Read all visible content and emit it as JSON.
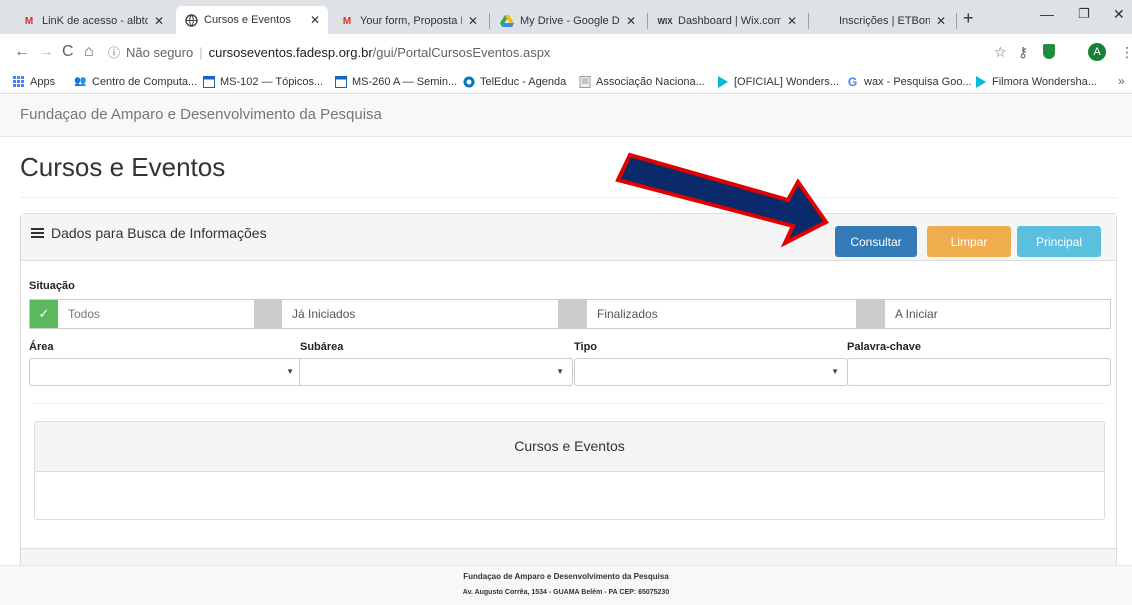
{
  "browser": {
    "tabs": [
      {
        "title": "LinK de acesso - albtdia",
        "icon": "gmail-icon"
      },
      {
        "title": "Cursos e Eventos",
        "icon": "globe-icon",
        "active": true
      },
      {
        "title": "Your form, Proposta ET",
        "icon": "gmail-icon"
      },
      {
        "title": "My Drive - Google Drive",
        "icon": "drive-icon"
      },
      {
        "title": "Dashboard | Wix.com",
        "icon": "wix-icon"
      },
      {
        "title": "Inscrições | ETBonline",
        "icon": "blank-icon"
      }
    ],
    "tab_close": "✕",
    "new_tab": "+",
    "url": {
      "security": "Não seguro",
      "host": "cursoseventos.fadesp.org.br",
      "path": "/gui/PortalCursosEventos.aspx"
    },
    "avatar_letter": "A",
    "bookmarks": [
      {
        "label": "Apps",
        "icon": "apps-grid-icon"
      },
      {
        "label": "Centro de Computa...",
        "icon": "people-icon"
      },
      {
        "label": "MS-102 — Tópicos...",
        "icon": "calendar-icon"
      },
      {
        "label": "MS-260 A — Semin...",
        "icon": "calendar-icon"
      },
      {
        "label": "TelEduc - Agenda",
        "icon": "teleduc-icon"
      },
      {
        "label": "Associação Naciona...",
        "icon": "doc-icon"
      },
      {
        "label": "[OFICIAL] Wonders...",
        "icon": "wondershare-icon"
      },
      {
        "label": "wax - Pesquisa Goo...",
        "icon": "google-icon"
      },
      {
        "label": "Filmora Wondersha...",
        "icon": "wondershare-icon"
      }
    ],
    "bookmarks_more": "»"
  },
  "site": {
    "brand": "Fundaçao de Amparo e Desenvolvimento da Pesquisa",
    "page_title": "Cursos e Eventos"
  },
  "search_panel": {
    "title": "Dados para Busca de Informações",
    "buttons": {
      "consultar": "Consultar",
      "limpar": "Limpar",
      "principal": "Principal"
    },
    "situacao_label": "Situação",
    "situacao_options": [
      {
        "label": "Todos",
        "checked": true,
        "check_mark": "✓"
      },
      {
        "label": "Já Iniciados",
        "checked": false
      },
      {
        "label": "Finalizados",
        "checked": false
      },
      {
        "label": "A Iniciar",
        "checked": false
      }
    ],
    "filters": {
      "area": "Área",
      "subarea": "Subárea",
      "tipo": "Tipo",
      "palavra_chave": "Palavra-chave"
    },
    "caret": "▼"
  },
  "results": {
    "title": "Cursos e Eventos"
  },
  "footer": {
    "line1": "Fundaçao de Amparo e Desenvolvimento da Pesquisa",
    "line2": "Av. Augusto Corrêa, 1534 - GUAMA Belém - PA CEP: 65075230"
  },
  "colors": {
    "consultar": "#337ab7",
    "limpar": "#f0ad4e",
    "principal": "#5bc0de",
    "checked": "#5cb85c",
    "annotation_arrow_fill": "#0b2a6b",
    "annotation_arrow_stroke": "#e00000"
  }
}
